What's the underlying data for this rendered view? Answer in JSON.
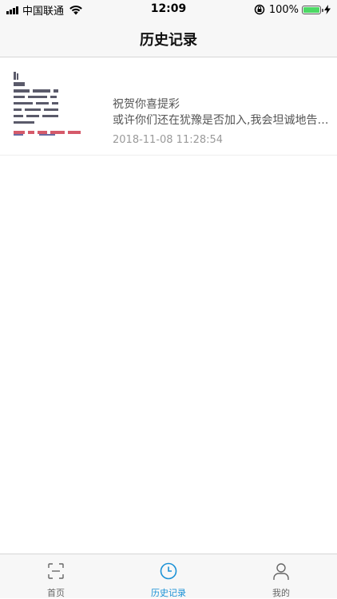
{
  "status_bar": {
    "carrier": "中国联通",
    "time": "12:09",
    "battery": "100%",
    "battery_level": 1.0
  },
  "nav": {
    "title": "历史记录"
  },
  "history": [
    {
      "text1": "祝贺你喜提彩",
      "text2": "或许你们还在犹豫是否加入,我会坦诚地告诉你们",
      "time": "2018-11-08 11:28:54"
    }
  ],
  "tabs": [
    {
      "label": "首页",
      "icon": "scan-icon"
    },
    {
      "label": "历史记录",
      "icon": "clock-icon"
    },
    {
      "label": "我的",
      "icon": "person-icon"
    }
  ],
  "colors": {
    "accent": "#1a91d6",
    "bar_bg": "#f7f7f7",
    "battery": "#4cd964"
  }
}
